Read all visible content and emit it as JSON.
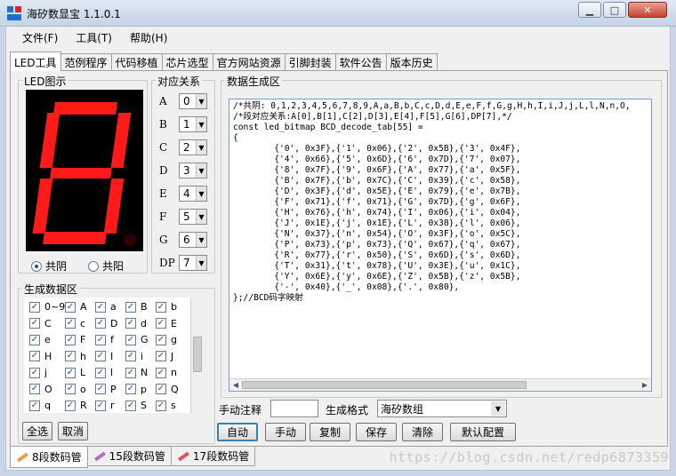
{
  "window": {
    "title": "海矽数显宝 1.1.0.1",
    "min_label": "▁",
    "max_label": "□",
    "close_label": "✕"
  },
  "menu": [
    "文件(F)",
    "工具(T)",
    "帮助(H)"
  ],
  "tabs": [
    "LED工具",
    "范例程序",
    "代码移植",
    "芯片选型",
    "官方网站资源",
    "引脚封装",
    "软件公告",
    "版本历史"
  ],
  "led_display": {
    "label": "LED图示",
    "segments_on": {
      "a": true,
      "b": true,
      "c": true,
      "d": true,
      "e": true,
      "f": true,
      "g": true
    },
    "dp_on": false,
    "common_cathode_label": "共阴",
    "common_anode_label": "共阳",
    "mode": "common_cathode"
  },
  "mapping": {
    "label": "对应关系",
    "rows": [
      {
        "seg": "A",
        "value": "0"
      },
      {
        "seg": "B",
        "value": "1"
      },
      {
        "seg": "C",
        "value": "2"
      },
      {
        "seg": "D",
        "value": "3"
      },
      {
        "seg": "E",
        "value": "4"
      },
      {
        "seg": "F",
        "value": "5"
      },
      {
        "seg": "G",
        "value": "6"
      },
      {
        "seg": "DP",
        "value": "7"
      }
    ]
  },
  "gen_data": {
    "label": "生成数据区",
    "items": [
      [
        "0~9",
        "A",
        "a",
        "B",
        "b"
      ],
      [
        "C",
        "c",
        "D",
        "d",
        "E"
      ],
      [
        "e",
        "F",
        "f",
        "G",
        "g"
      ],
      [
        "H",
        "h",
        "I",
        "i",
        "J"
      ],
      [
        "j",
        "L",
        "l",
        "N",
        "n"
      ],
      [
        "O",
        "o",
        "P",
        "p",
        "Q"
      ],
      [
        "q",
        "R",
        "r",
        "S",
        "s"
      ]
    ],
    "select_all_label": "全选",
    "cancel_label": "取消"
  },
  "code_area": {
    "label": "数据生成区",
    "lines": [
      "/*共阴: 0,1,2,3,4,5,6,7,8,9,A,a,B,b,C,c,D,d,E,e,F,f,G,g,H,h,I,i,J,j,L,l,N,n,O,",
      "/*段对应关系:A[0],B[1],C[2],D[3],E[4],F[5],G[6],DP[7],*/",
      "const led_bitmap BCD_decode_tab[55] =",
      "{",
      "        {'0', 0x3F},{'1', 0x06},{'2', 0x5B},{'3', 0x4F},",
      "        {'4', 0x66},{'5', 0x6D},{'6', 0x7D},{'7', 0x07},",
      "        {'8', 0x7F},{'9', 0x6F},{'A', 0x77},{'a', 0x5F},",
      "        {'B', 0x7F},{'b', 0x7C},{'C', 0x39},{'c', 0x58},",
      "        {'D', 0x3F},{'d', 0x5E},{'E', 0x79},{'e', 0x7B},",
      "        {'F', 0x71},{'f', 0x71},{'G', 0x7D},{'g', 0x6F},",
      "        {'H', 0x76},{'h', 0x74},{'I', 0x06},{'i', 0x04},",
      "        {'J', 0x1E},{'j', 0x1E},{'L', 0x38},{'l', 0x06},",
      "        {'N', 0x37},{'n', 0x54},{'O', 0x3F},{'o', 0x5C},",
      "        {'P', 0x73},{'p', 0x73},{'Q', 0x67},{'q', 0x67},",
      "        {'R', 0x77},{'r', 0x50},{'S', 0x6D},{'s', 0x6D},",
      "        {'T', 0x31},{'t', 0x78},{'U', 0x3E},{'u', 0x1C},",
      "        {'Y', 0x6E},{'y', 0x6E},{'Z', 0x5B},{'z', 0x5B},",
      "        {'-', 0x40},{'_', 0x08},{'.', 0x80},",
      "};//BCD码字映射"
    ]
  },
  "controls": {
    "manual_comment_label": "手动注释",
    "manual_comment_value": "",
    "format_label": "生成格式",
    "format_value": "海矽数组",
    "buttons": [
      "自动",
      "手动",
      "复制",
      "保存",
      "清除",
      "默认配置"
    ]
  },
  "bottom_tabs": [
    "8段数码管",
    "15段数码管",
    "17段数码管"
  ],
  "watermark": "https://blog.csdn.net/redp6873359",
  "colors": {
    "led_on": "#ff1a1a",
    "led_off": "#2a0000",
    "accent": "#3c7fb1"
  }
}
